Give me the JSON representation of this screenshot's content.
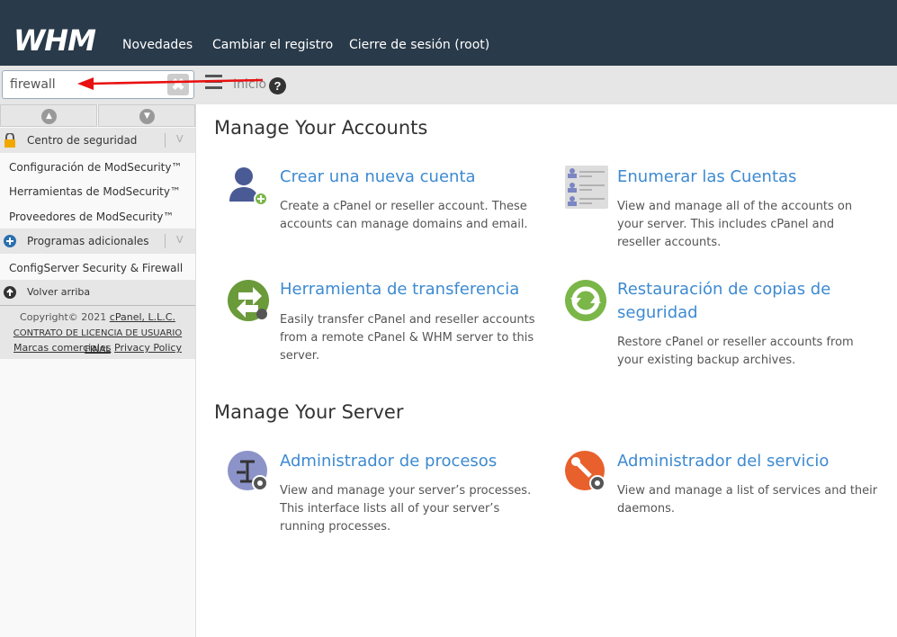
{
  "header": {
    "logo": "WHM",
    "nav": [
      "Novedades",
      "Cambiar el registro",
      "Cierre de sesión (root)"
    ]
  },
  "toolbar": {
    "search_value": "firewall",
    "clear": "✖",
    "home": "Inicio",
    "help": "?"
  },
  "sidebar": {
    "groups": [
      {
        "label": "Centro de seguridad",
        "items": [
          "Configuración de ModSecurity™",
          "Herramientas de ModSecurity™",
          "Proveedores de ModSecurity™"
        ]
      },
      {
        "label": "Programas adicionales",
        "items": [
          "ConfigServer Security & Firewall"
        ]
      }
    ],
    "back_to_top": "Volver arriba",
    "footer": {
      "copyright": "Copyright© 2021",
      "company": "cPanel, L.L.C.",
      "eula": "CONTRATO DE LICENCIA DE USUARIO FINAL",
      "trademarks": "Marcas comerciales",
      "privacy": "Privacy Policy"
    }
  },
  "main": {
    "sections": [
      {
        "title": "Manage Your Accounts",
        "cards": [
          {
            "title": "Crear una nueva cuenta",
            "desc": "Create a cPanel or reseller account. These accounts can manage domains and email."
          },
          {
            "title": "Enumerar las Cuentas",
            "desc": "View and manage all of the accounts on your server. This includes cPanel and reseller accounts."
          },
          {
            "title": "Herramienta de transferencia",
            "desc": "Easily transfer cPanel and reseller accounts from a remote cPanel & WHM server to this server."
          },
          {
            "title": "Restauración de copias de seguridad",
            "desc": "Restore cPanel or reseller accounts from your existing backup archives."
          }
        ]
      },
      {
        "title": "Manage Your Server",
        "cards": [
          {
            "title": "Administrador de procesos",
            "desc": "View and manage your server’s processes. This interface lists all of your server’s running processes."
          },
          {
            "title": "Administrador del servicio",
            "desc": "View and manage a list of services and their daemons."
          }
        ]
      }
    ]
  },
  "colors": {
    "header": "#293a4a",
    "link": "#3d8ad1",
    "annotation_arrow": "#e81010"
  }
}
